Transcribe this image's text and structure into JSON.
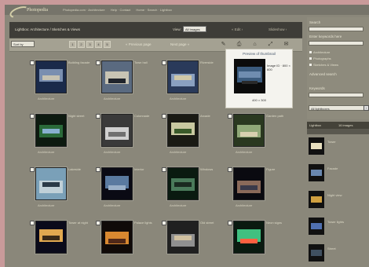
{
  "app": {
    "logo_text": "Photopedia",
    "top_nav": [
      "Photopedia.com · Architecture",
      "Help · Contact",
      "Home · Search · Lightbox"
    ]
  },
  "gallery": {
    "title": "Lightbox: Architecture / Sketches & Views",
    "view_label": "View:",
    "view_value": "All Images",
    "btn_edit": "« Edit ›",
    "btn_slideshow": "Slideshow ›",
    "sort_value": "Sort by",
    "pager": [
      "1",
      "2",
      "3",
      "4",
      "5"
    ],
    "prev_label": "« Previous page",
    "next_label": "Next page »",
    "tools": [
      "✎",
      "⎙",
      "⌂",
      "⤢",
      "✉"
    ]
  },
  "popup": {
    "title": "Preview of thumbnail",
    "caption": "Image ID · 800 × 600",
    "size": "400 × 300"
  },
  "thumbnails": [
    {
      "caption": "Building facade",
      "sub": "Architecture"
    },
    {
      "caption": "Town hall",
      "sub": "Architecture"
    },
    {
      "caption": "Riverside",
      "sub": "Architecture"
    },
    {
      "caption": "Preview",
      "sub": ""
    },
    {
      "caption": "Night street",
      "sub": "Architecture"
    },
    {
      "caption": "Colonnade",
      "sub": "Architecture"
    },
    {
      "caption": "Arcade",
      "sub": "Architecture"
    },
    {
      "caption": "Garden path",
      "sub": "Architecture"
    },
    {
      "caption": "Lakeside",
      "sub": "Architecture"
    },
    {
      "caption": "Interior",
      "sub": "Architecture"
    },
    {
      "caption": "Windows",
      "sub": "Architecture"
    },
    {
      "caption": "Figure",
      "sub": "Architecture"
    },
    {
      "caption": "Tower at night",
      "sub": ""
    },
    {
      "caption": "Palace lights",
      "sub": ""
    },
    {
      "caption": "Old street",
      "sub": ""
    },
    {
      "caption": "Neon signs",
      "sub": ""
    }
  ],
  "sidebar": {
    "search_label": "Search",
    "search_hint": "Enter keywords here",
    "checks": [
      "Architecture",
      "Photographs",
      "Sketches & Views"
    ],
    "adv_label": "Advanced search",
    "filter_label": "Keywords",
    "select_label": "All lightboxes",
    "go_label": "›",
    "lightbox_title": "Lightbox",
    "lightbox_count": "16 images",
    "items": [
      {
        "caption": "Tower"
      },
      {
        "caption": "Facade"
      },
      {
        "caption": "Night view"
      },
      {
        "caption": "Tower lights"
      },
      {
        "caption": "Street"
      }
    ]
  },
  "colors": {
    "page": "#c99a9a",
    "panel": "#8a877a",
    "titlebar": "#3e3d38",
    "popup": "#f4f3ee"
  }
}
